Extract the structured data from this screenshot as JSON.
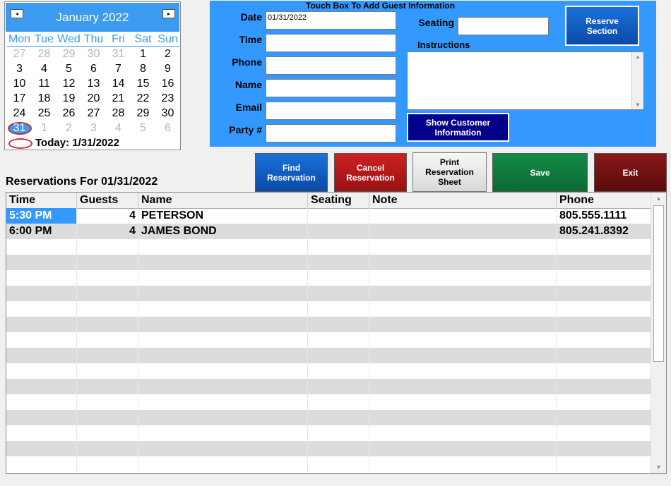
{
  "calendar": {
    "month_label": "January 2022",
    "prev_icon": "◂",
    "next_icon": "▸",
    "weekdays": [
      "Mon",
      "Tue",
      "Wed",
      "Thu",
      "Fri",
      "Sat",
      "Sun"
    ],
    "weeks": [
      [
        "27",
        "28",
        "29",
        "30",
        "31",
        "1",
        "2"
      ],
      [
        "3",
        "4",
        "5",
        "6",
        "7",
        "8",
        "9"
      ],
      [
        "10",
        "11",
        "12",
        "13",
        "14",
        "15",
        "16"
      ],
      [
        "17",
        "18",
        "19",
        "20",
        "21",
        "22",
        "23"
      ],
      [
        "24",
        "25",
        "26",
        "27",
        "28",
        "29",
        "30"
      ],
      [
        "31",
        "1",
        "2",
        "3",
        "4",
        "5",
        "6"
      ]
    ],
    "today_label": "Today: 1/31/2022"
  },
  "guest_form": {
    "title": "Touch Box To Add Guest Information",
    "date_label": "Date",
    "date_value": "01/31/2022",
    "time_label": "Time",
    "time_value": "",
    "phone_label": "Phone",
    "phone_value": "",
    "name_label": "Name",
    "name_value": "",
    "email_label": "Email",
    "email_value": "",
    "party_label": "Party #",
    "party_value": "",
    "seating_label": "Seating",
    "seating_value": "",
    "instructions_label": "Instructions",
    "instructions_value": ""
  },
  "buttons": {
    "reserve_section_l1": "Reserve",
    "reserve_section_l2": "Section",
    "show_customer_l1": "Show Customer",
    "show_customer_l2": "Information",
    "find_l1": "Find",
    "find_l2": "Reservation",
    "cancel_l1": "Cancel",
    "cancel_l2": "Reservation",
    "print_l1": "Print",
    "print_l2": "Reservation",
    "print_l3": "Sheet",
    "save": "Save",
    "exit": "Exit"
  },
  "reservations": {
    "heading": "Reservations For 01/31/2022",
    "columns": [
      "Time",
      "Guests",
      "Name",
      "Seating",
      "Note",
      "Phone"
    ],
    "rows": [
      {
        "time": "5:30 PM",
        "guests": "4",
        "name": "PETERSON",
        "seating": "",
        "note": "",
        "phone": "805.555.1111"
      },
      {
        "time": "6:00 PM",
        "guests": "4",
        "name": "JAMES BOND",
        "seating": "",
        "note": "",
        "phone": "805.241.8392"
      }
    ]
  },
  "colors": {
    "accent": "#3399ff",
    "calendar_header": "#3c9bf0",
    "today_ring": "#c0303a"
  }
}
